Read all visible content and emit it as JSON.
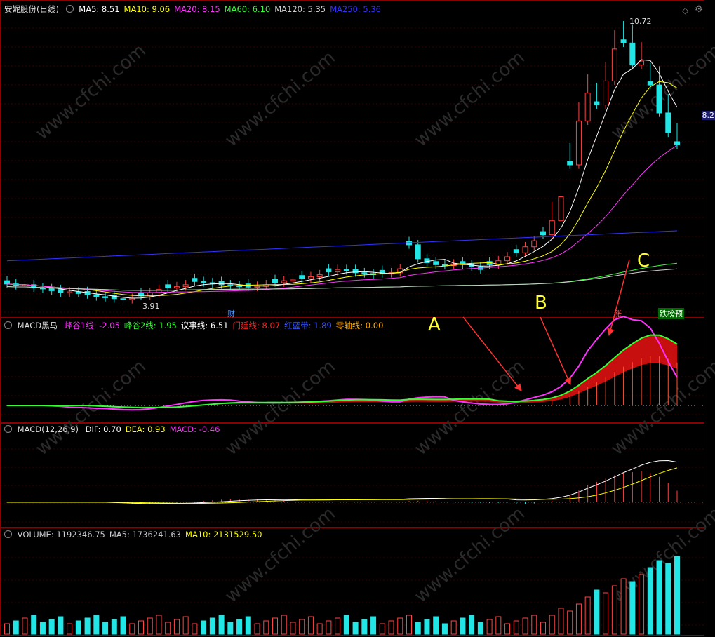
{
  "chart_data": [
    {
      "type": "candlestick",
      "title": "安妮股份(日线)",
      "ma_legend": [
        {
          "name": "MA5",
          "value": "8.51",
          "color": "#ffffff"
        },
        {
          "name": "MA10",
          "value": "9.06",
          "color": "#ffff00"
        },
        {
          "name": "MA20",
          "value": "8.15",
          "color": "#ff33ff"
        },
        {
          "name": "MA60",
          "value": "6.10",
          "color": "#33ff33"
        },
        {
          "name": "MA120",
          "value": "5.35",
          "color": "#cccccc"
        },
        {
          "name": "MA250",
          "value": "5.36",
          "color": "#3333ff"
        }
      ],
      "high_label": "10.72",
      "low_label": "3.91",
      "side_price": "8.2",
      "tags": [
        {
          "text": "财",
          "color": "#5599ff"
        },
        {
          "text": "涨",
          "color": "#ff5555"
        },
        {
          "text": "跌榜预",
          "color": "#ffffff",
          "bg": "#006600"
        }
      ],
      "candles_close": [
        4.32,
        4.28,
        4.3,
        4.22,
        4.2,
        4.15,
        4.1,
        4.12,
        4.08,
        4.05,
        4.0,
        3.98,
        3.95,
        3.93,
        3.96,
        4.02,
        4.1,
        4.18,
        4.22,
        4.25,
        4.3,
        4.38,
        4.35,
        4.32,
        4.3,
        4.28,
        4.25,
        4.24,
        4.26,
        4.3,
        4.35,
        4.4,
        4.42,
        4.45,
        4.5,
        4.55,
        4.62,
        4.68,
        4.65,
        4.6,
        4.58,
        4.55,
        4.58,
        4.6,
        4.7,
        5.3,
        4.95,
        4.85,
        4.8,
        4.78,
        4.82,
        4.8,
        4.75,
        4.68,
        4.8,
        4.9,
        5.0,
        5.1,
        5.25,
        5.4,
        5.55,
        5.9,
        6.5,
        7.3,
        8.4,
        9.1,
        8.8,
        9.4,
        10.2,
        10.35,
        9.8,
        9.9,
        9.3,
        8.6,
        8.1,
        7.8
      ],
      "annotations": [
        "A",
        "B",
        "C"
      ]
    },
    {
      "type": "line",
      "title": "MACD黑马",
      "legend": [
        {
          "name": "峰谷1线",
          "value": "-2.05",
          "color": "#ff33ff"
        },
        {
          "name": "峰谷2线",
          "value": "1.95",
          "color": "#33ff33"
        },
        {
          "name": "议事线",
          "value": "6.51",
          "color": "#ffffff"
        },
        {
          "name": "门廷线",
          "value": "8.07",
          "color": "#ff2222"
        },
        {
          "name": "红蓝带",
          "value": "1.89",
          "color": "#3355ff"
        },
        {
          "name": "零轴线",
          "value": "0.00",
          "color": "#ffaa00"
        }
      ]
    },
    {
      "type": "line",
      "title": "MACD(12,26,9)",
      "legend": [
        {
          "name": "DIF",
          "value": "0.70",
          "color": "#ffffff"
        },
        {
          "name": "DEA",
          "value": "0.93",
          "color": "#ffff00"
        },
        {
          "name": "MACD",
          "value": "-0.46",
          "color": "#ff33ff"
        }
      ]
    },
    {
      "type": "bar",
      "title": "VOLUME",
      "legend": [
        {
          "name": "VOLUME",
          "value": "1192346.75",
          "color": "#cccccc"
        },
        {
          "name": "MA5",
          "value": "1736241.63",
          "color": "#cccccc"
        },
        {
          "name": "MA10",
          "value": "2131529.50",
          "color": "#ffff00"
        }
      ]
    }
  ],
  "icons": {
    "settings": "gear-icon",
    "diamond": "diamond-icon"
  },
  "watermark_text": "www.cfchi.com"
}
